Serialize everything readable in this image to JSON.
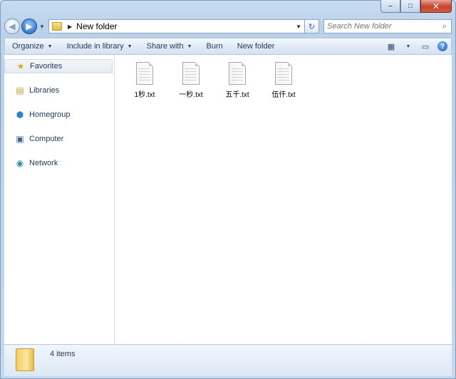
{
  "window": {
    "caption": {
      "minimize": "–",
      "maximize": "□",
      "close": "✕"
    }
  },
  "nav": {
    "back_glyph": "◀",
    "forward_glyph": "▶",
    "recent_glyph": "▼"
  },
  "address": {
    "path": "New folder",
    "arrow": "▶",
    "dropdown": "▼",
    "refresh_glyph": "↻"
  },
  "search": {
    "placeholder": "Search New folder",
    "icon_glyph": "⌕"
  },
  "toolbar": {
    "organize": "Organize",
    "include_in_library": "Include in library",
    "share_with": "Share with",
    "burn": "Burn",
    "new_folder": "New folder",
    "views_glyph": "▦",
    "views_dropdown": "▼",
    "preview_glyph": "▭",
    "help_glyph": "?"
  },
  "sidebar": {
    "items": [
      {
        "label": "Favorites",
        "icon": "star-icon",
        "glyph": "★",
        "color": "#e2a418"
      },
      {
        "label": "Libraries",
        "icon": "libraries-icon",
        "glyph": "▤",
        "color": "#c99a2e"
      },
      {
        "label": "Homegroup",
        "icon": "homegroup-icon",
        "glyph": "⬢",
        "color": "#2e7fd0"
      },
      {
        "label": "Computer",
        "icon": "computer-icon",
        "glyph": "▣",
        "color": "#3b5f8f"
      },
      {
        "label": "Network",
        "icon": "network-icon",
        "glyph": "◉",
        "color": "#2e8fa8"
      }
    ]
  },
  "files": [
    {
      "name": "1秒.txt"
    },
    {
      "name": "一秒.txt"
    },
    {
      "name": "五千.txt"
    },
    {
      "name": "伍仟.txt"
    }
  ],
  "status": {
    "item_count": "4 items"
  }
}
